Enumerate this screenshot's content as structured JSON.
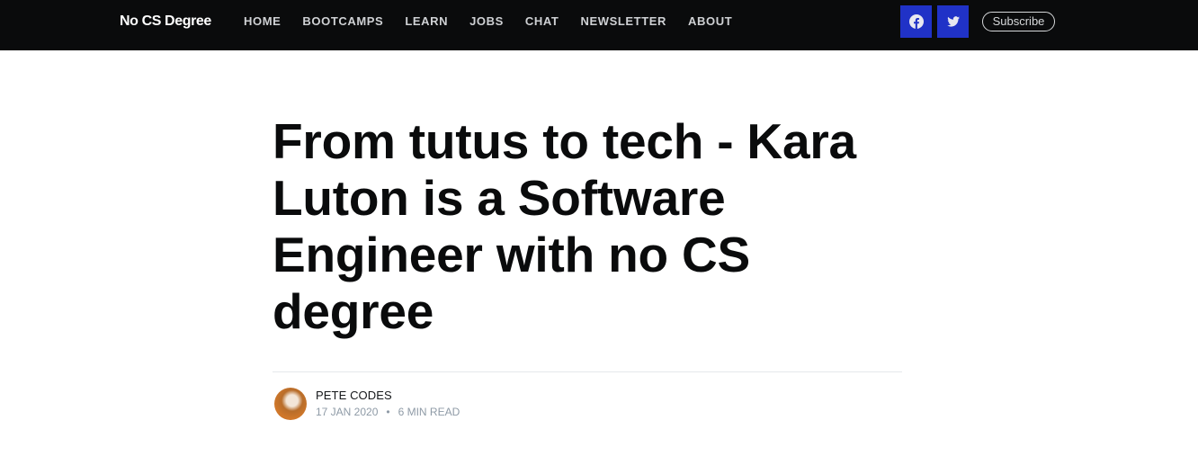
{
  "header": {
    "brand": "No CS Degree",
    "nav": [
      "HOME",
      "BOOTCAMPS",
      "LEARN",
      "JOBS",
      "CHAT",
      "NEWSLETTER",
      "ABOUT"
    ],
    "social": [
      {
        "name": "facebook",
        "icon": "facebook-icon"
      },
      {
        "name": "twitter",
        "icon": "twitter-icon"
      }
    ],
    "subscribe_label": "Subscribe",
    "colors": {
      "background": "#0a0b0c",
      "social_bg": "#2032c7"
    }
  },
  "post": {
    "title": "From tutus to tech - Kara Luton is a Software Engineer with no CS degree",
    "author": "PETE CODES",
    "date": "17 JAN 2020",
    "separator": "•",
    "reading_time": "6 MIN READ"
  }
}
